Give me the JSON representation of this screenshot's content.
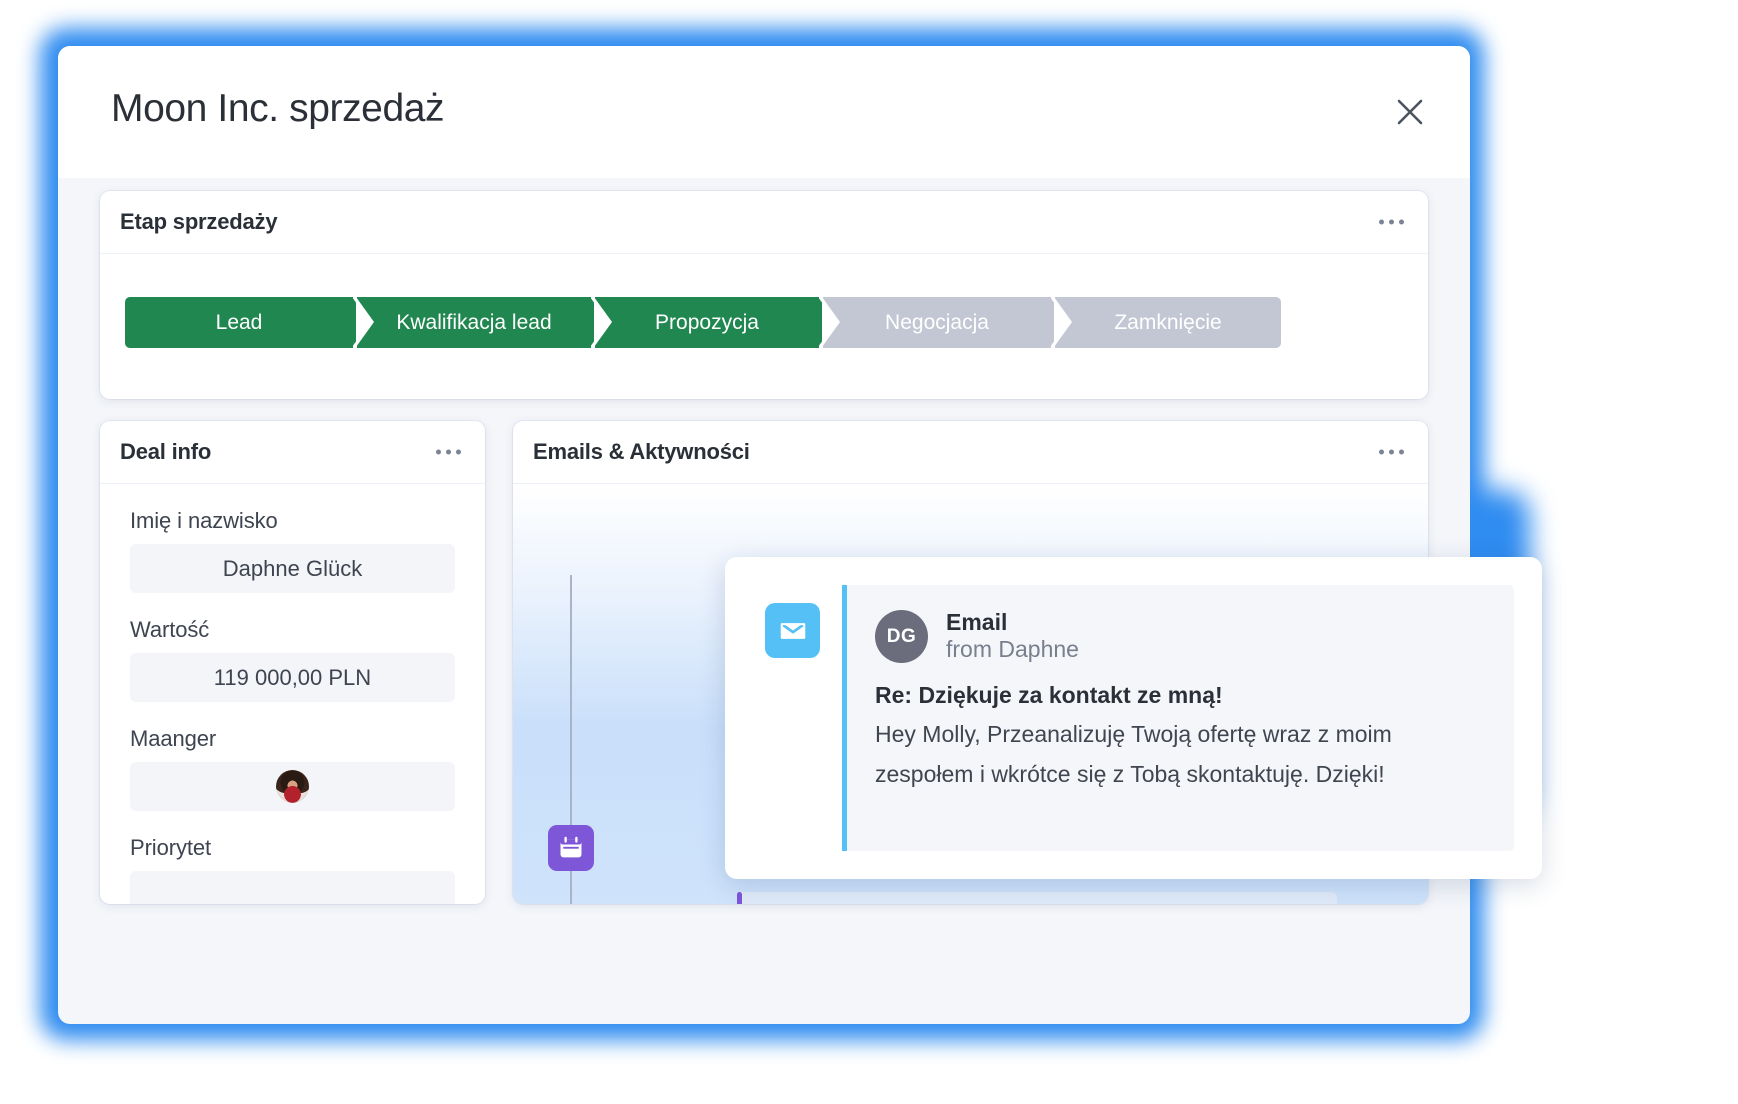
{
  "window": {
    "title": "Moon Inc. sprzedaż",
    "close_icon": "close-icon"
  },
  "pipeline": {
    "title": "Etap sprzedaży",
    "menu_icon": "ellipsis-icon",
    "active_color": "#218751",
    "inactive_color": "#c3c7d4",
    "stages": [
      {
        "label": "Lead",
        "state": "done"
      },
      {
        "label": "Kwalifikacja lead",
        "state": "done"
      },
      {
        "label": "Propozycja",
        "state": "done"
      },
      {
        "label": "Negocjacja",
        "state": "todo"
      },
      {
        "label": "Zamknięcie",
        "state": "todo"
      }
    ]
  },
  "deal_info": {
    "title": "Deal info",
    "menu_icon": "ellipsis-icon",
    "fields": [
      {
        "label": "Imię i nazwisko",
        "value": "Daphne Glück",
        "type": "text"
      },
      {
        "label": "Wartość",
        "value": "119 000,00 PLN",
        "type": "text"
      },
      {
        "label": "Maanger",
        "value": "",
        "type": "avatar"
      },
      {
        "label": "Priorytet",
        "value": "",
        "type": "text"
      }
    ]
  },
  "emails": {
    "title": "Emails & Aktywności",
    "menu_icon": "ellipsis-icon",
    "timeline": {
      "calendar_icon": "calendar-icon",
      "calendar_color": "#7e56d8",
      "accent_colors": [
        "#7e56d8",
        "#e8b423"
      ]
    }
  },
  "email_card": {
    "icon": "envelope-icon",
    "icon_color": "#54c0f5",
    "avatar_initials": "DG",
    "kind": "Email",
    "from": "from Daphne",
    "subject": "Re: Dziękuje za kontakt ze mną!",
    "body": "Hey Molly, Przeanalizuję Twoją ofertę wraz z moim zespołem i wkrótce się z Tobą skontaktuję. Dzięki!"
  }
}
